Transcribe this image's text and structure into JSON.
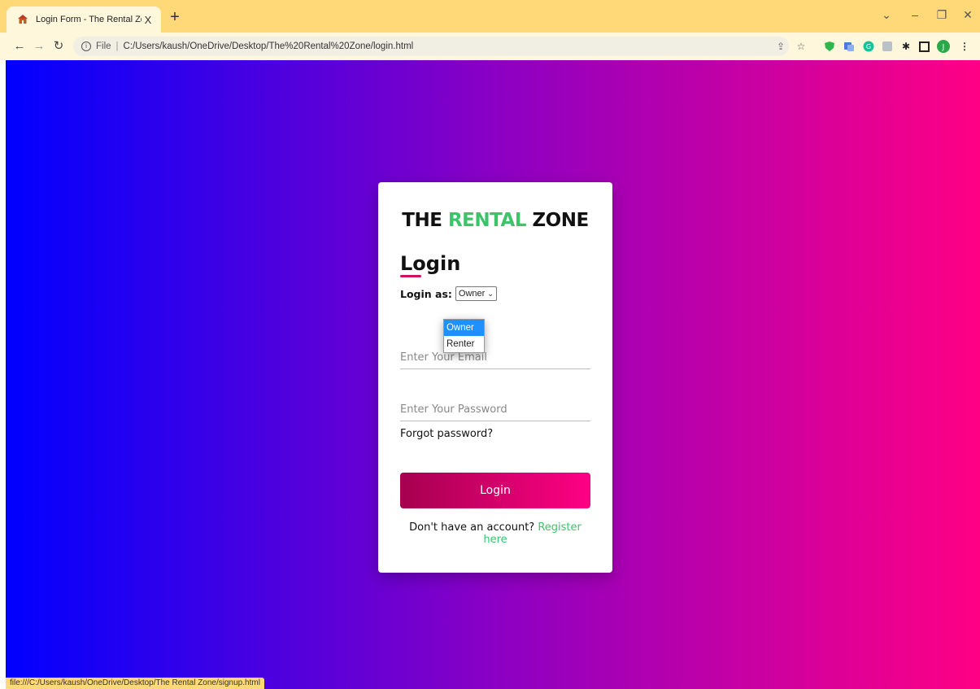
{
  "browser": {
    "tab_title": "Login Form - The Rental Zone",
    "tab_close": "X",
    "new_tab": "+",
    "address_scheme": "File",
    "address_sep": "|",
    "address_url": "C:/Users/kaush/OneDrive/Desktop/The%20Rental%20Zone/login.html",
    "status_url": "file:///C:/Users/kaush/OneDrive/Desktop/The Rental Zone/signup.html",
    "profile_initial": "J"
  },
  "brand": {
    "part1": "THE ",
    "part2": "RENTAL",
    "part3": " ZONE",
    "accent_color": "#3cc46b"
  },
  "form": {
    "heading": "Login",
    "role_label": "Login as:",
    "role_selected": "Owner",
    "role_options": [
      "Owner",
      "Renter"
    ],
    "email_placeholder": "Enter Your Email",
    "password_placeholder": "Enter Your Password",
    "forgot": "Forgot password?",
    "submit": "Login",
    "signup_prompt": "Don't have an account?",
    "signup_link": "Register here"
  },
  "colors": {
    "gradient_start": "#0000ff",
    "gradient_end": "#ff0084",
    "button_start": "#a6004f",
    "button_end": "#ff0084"
  }
}
